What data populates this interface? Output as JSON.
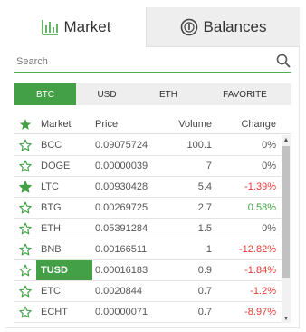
{
  "tabs": {
    "market": "Market",
    "balances": "Balances"
  },
  "search": {
    "placeholder": "Search"
  },
  "currency_tabs": [
    "BTC",
    "USD",
    "ETH",
    "FAVORITE"
  ],
  "table": {
    "headers": {
      "market": "Market",
      "price": "Price",
      "volume": "Volume",
      "change": "Change"
    },
    "rows": [
      {
        "favorite": false,
        "market": "BCC",
        "price": "0.09075724",
        "volume": "100.1",
        "change": "0%",
        "trend": "flat"
      },
      {
        "favorite": false,
        "market": "DOGE",
        "price": "0.00000039",
        "volume": "7",
        "change": "0%",
        "trend": "flat"
      },
      {
        "favorite": true,
        "market": "LTC",
        "price": "0.00930428",
        "volume": "5.4",
        "change": "-1.39%",
        "trend": "down"
      },
      {
        "favorite": false,
        "market": "BTG",
        "price": "0.00269725",
        "volume": "2.7",
        "change": "0.58%",
        "trend": "up"
      },
      {
        "favorite": false,
        "market": "ETH",
        "price": "0.05391284",
        "volume": "1.5",
        "change": "0%",
        "trend": "flat"
      },
      {
        "favorite": false,
        "market": "BNB",
        "price": "0.00166511",
        "volume": "1",
        "change": "-12.82%",
        "trend": "down"
      },
      {
        "favorite": false,
        "market": "TUSD",
        "price": "0.00016183",
        "volume": "0.9",
        "change": "-1.84%",
        "trend": "down",
        "selected": true
      },
      {
        "favorite": false,
        "market": "ETC",
        "price": "0.0020844",
        "volume": "0.7",
        "change": "-1.2%",
        "trend": "down"
      },
      {
        "favorite": false,
        "market": "ECHT",
        "price": "0.00000071",
        "volume": "0.7",
        "change": "-8.97%",
        "trend": "down"
      }
    ]
  },
  "colors": {
    "accent": "#43a047",
    "negative": "#e53935",
    "tab_inactive_bg": "#eeeeee"
  },
  "icons": {
    "market_tab": "bar-chart-icon",
    "balances_tab": "coin-icon",
    "search": "search-icon",
    "favorite": "star-icon"
  }
}
